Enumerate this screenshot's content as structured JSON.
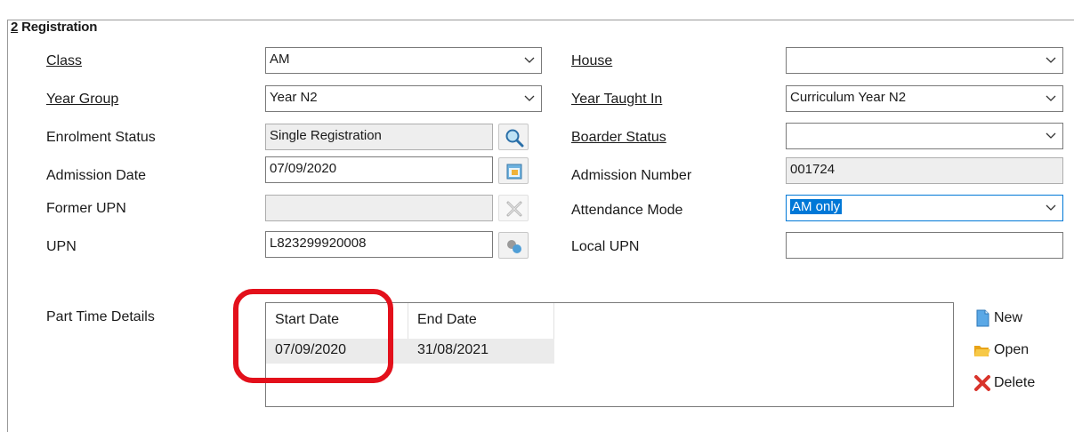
{
  "section": {
    "number": "2",
    "title": "Registration"
  },
  "left_fields": {
    "class": {
      "label": "Class",
      "value": "AM"
    },
    "year_group": {
      "label": "Year Group",
      "value": "Year N2"
    },
    "enrolment_status": {
      "label": "Enrolment Status",
      "value": "Single Registration"
    },
    "admission_date": {
      "label": "Admission Date",
      "value": "07/09/2020"
    },
    "former_upn": {
      "label": "Former UPN",
      "value": ""
    },
    "upn": {
      "label": "UPN",
      "value": "L823299920008"
    }
  },
  "right_fields": {
    "house": {
      "label": "House",
      "value": ""
    },
    "year_taught_in": {
      "label": "Year Taught In",
      "value": "Curriculum Year N2"
    },
    "boarder_status": {
      "label": "Boarder Status",
      "value": ""
    },
    "admission_number": {
      "label": "Admission Number",
      "value": "001724"
    },
    "attendance_mode": {
      "label": "Attendance Mode",
      "value": "AM only"
    },
    "local_upn": {
      "label": "Local UPN",
      "value": ""
    }
  },
  "part_time": {
    "label": "Part Time Details",
    "columns": [
      "Start Date",
      "End Date"
    ],
    "rows": [
      [
        "07/09/2020",
        "31/08/2021"
      ]
    ]
  },
  "actions": {
    "new": "New",
    "open": "Open",
    "delete": "Delete"
  },
  "icons": {
    "enrolment_lookup": "magnifier-icon",
    "admission_date_picker": "calendar-icon",
    "former_upn_clear": "clear-x-icon",
    "upn_generate": "generate-upn-icon",
    "new": "new-document-icon",
    "open": "open-folder-icon",
    "delete": "delete-x-icon"
  },
  "colors": {
    "annotation_ring": "#e3101b",
    "selection": "#0078d7"
  }
}
